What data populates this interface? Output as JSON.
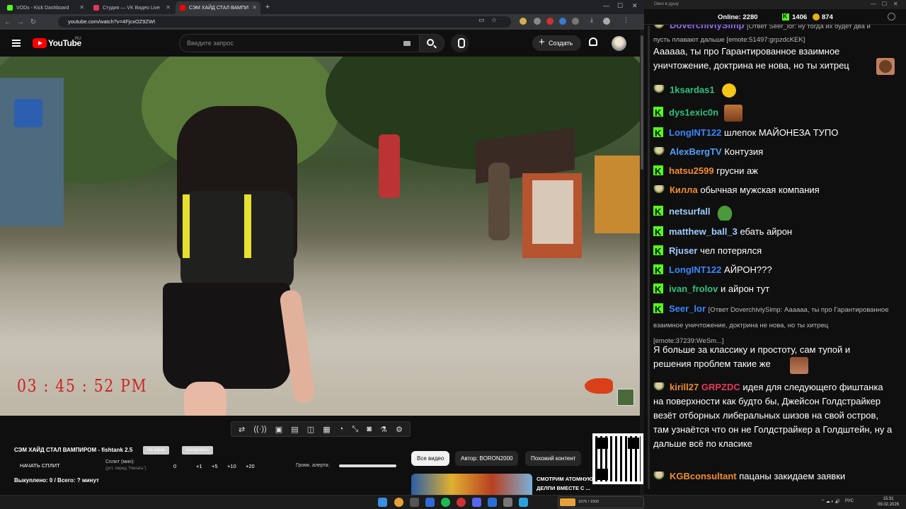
{
  "browser": {
    "tabs": [
      {
        "label": "VODs - Kick Dashboard",
        "icon": "kick-icon",
        "color": "#53fc18"
      },
      {
        "label": "Студия — VK Видео Live",
        "icon": "vk-video-icon",
        "color": "#e8365a"
      },
      {
        "label": "СЭМ ХАЙД СТАЛ ВАМПИ",
        "icon": "youtube-icon",
        "color": "#ff0000",
        "active": true
      }
    ],
    "url": "youtube.com/watch?v=4FjcxOZ9ZWI"
  },
  "youtube": {
    "brand": "YouTube",
    "region": "RU",
    "search_placeholder": "Введите запрос",
    "create_label": "Создать"
  },
  "video": {
    "overlay_time": "03 : 45 : 52 PM"
  },
  "stream_panel": {
    "title": "СЭМ ХАЙД СТАЛ ВАМПИРОМ - fishtank 2.5",
    "pill_1": "На экран",
    "pill_2": "Копировать",
    "start_split": "НАЧАТЬ СПЛИТ",
    "split_label": "Сплит (мин):",
    "split_sub": "(уст. перед \"Начать\")",
    "split_value": "0",
    "increments": [
      "+1",
      "+5",
      "+10",
      "+20"
    ],
    "alert_volume_label": "Громк. алерта:",
    "bought": "Выкуплено: 0 / Всего: ? минут"
  },
  "related": {
    "chips": [
      "Все видео",
      "Автор: BORON2000",
      "Похожий контент"
    ],
    "first_title": "СМОТРИМ АТОМНУЮ БОМБУ ДЕЛПИ ВМЕСТЕ С ..."
  },
  "chat": {
    "window_title": "Окно в душу",
    "online_label": "Online:",
    "online_count": "2280",
    "kick_count": "1406",
    "vk_count": "874",
    "messages": [
      {
        "source": "vk",
        "nick": "DoverchiviySimp",
        "nick_color": "#9b6cff",
        "reply": "[Ответ Seer_lor: ну тогда их будет два и"
      },
      {
        "text": "пусть плавают дальше [emote:51497:grpzdcKEK]"
      },
      {
        "text": "Аааааа, ты про Гарантированное взаимное уничтожение, доктрина не нова, но ты хитрец"
      },
      {
        "source": "vk",
        "nick": "1ksardas1",
        "nick_color": "#2ec27e",
        "emote": "laugh-emote"
      },
      {
        "source": "kick",
        "nick": "dys1exic0n",
        "nick_color": "#2ec27e",
        "emote": "face-emote"
      },
      {
        "source": "kick",
        "nick": "LongINT122",
        "nick_color": "#3a86ff",
        "text": "шлепок МАЙОНЕЗА ТУПО"
      },
      {
        "source": "vk",
        "nick": "AlexBergTV",
        "nick_color": "#4d9fff",
        "text": "Контузия"
      },
      {
        "source": "kick",
        "nick": "hatsu2599",
        "nick_color": "#f08c2e",
        "text": "грусни аж"
      },
      {
        "source": "vk",
        "nick": "Килла",
        "nick_color": "#f08c2e",
        "text": "обычная мужская компания"
      },
      {
        "source": "kick",
        "nick": "netsurfall",
        "nick_color": "#9ecbff",
        "emote": "pepe-emote"
      },
      {
        "source": "kick",
        "nick": "matthew_ball_3",
        "nick_color": "#9ecbff",
        "text": "ебать айрон"
      },
      {
        "source": "kick",
        "nick": "Rjuser",
        "nick_color": "#9ecbff",
        "text": "чел потерялся"
      },
      {
        "source": "kick",
        "nick": "LongINT122",
        "nick_color": "#3a86ff",
        "text": "АЙРОН???"
      },
      {
        "source": "kick",
        "nick": "ivan_frolov",
        "nick_color": "#2ec27e",
        "text": "и айрон тут"
      },
      {
        "source": "kick",
        "nick": "Seer_lor",
        "nick_color": "#3a86ff",
        "reply": "[Ответ DoverchiviySimp: Аааааа, ты про Гарантированное взаимное уничтожение, доктрина не нова, но ты хитрец [emote:37239:WeSm...]"
      },
      {
        "text": "Я больше за классику и простоту, сам тупой и решения проблем такие же"
      },
      {
        "source": "vk",
        "nick": "kirill27",
        "nick_color": "#f08c2e",
        "mention": "GRPZDC",
        "text": "идея для следующего фиштанка на поверхности как будто бы, Джейсон Голдстрайкер везёт отборных либеральных шизов на свой остров, там узнаётся что он не Голдстрайкер а Голдштейн, ну а дальше всё по класике"
      },
      {
        "source": "vk",
        "nick": "KGBconsultant",
        "nick_color": "#f08c2e",
        "text": "пацаны закидаем заявки"
      }
    ]
  },
  "taskbar": {
    "banner": "1076 / 1500",
    "lang": "РУС",
    "time": "15:31",
    "date": "09.02.2026"
  }
}
